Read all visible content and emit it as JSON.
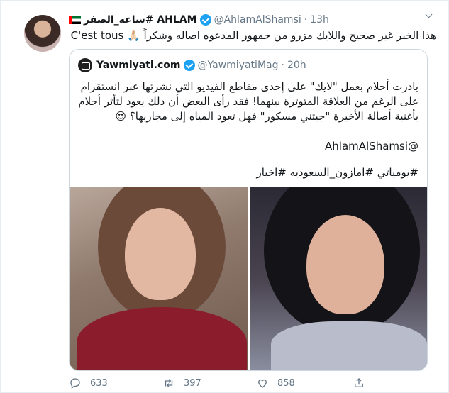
{
  "tweet": {
    "display_name": "ساعة_الصفر# AHLAM",
    "handle": "@AhlamAlShamsi",
    "separator": "·",
    "time": "13h",
    "text": "هذا الخبر غير صحيح واللايك مزرو من جمهور المدعوه اصاله وشكراً 🙏🏻 C'est tous"
  },
  "quote": {
    "display_name": "Yawmiyati.com",
    "handle": "@YawmiyatiMag",
    "separator": "·",
    "time": "20h",
    "text": "بادرت أحلام بعمل \"لايك\" على إحدى مقاطع الفيديو التي نشرتها عبر انستقرام على الرغم من العلاقة المتوترة بينهما! فقد رأى البعض أن ذلك يعود لتأثر أحلام بأغنية أصالة الأخيرة \"جيتني مسكور\" فهل تعود المياه إلى مجاريها؟ 😍",
    "mention": "@AhlamAlShamsi",
    "hashtags": "#يومياتي #امازون_السعوديه #اخبار"
  },
  "actions": {
    "replies": "633",
    "retweets": "397",
    "likes": "858"
  },
  "colors": {
    "accent": "#1da1f2",
    "muted": "#657786",
    "border": "#e6ecf0"
  },
  "icons": [
    "verified-badge-icon",
    "caret-down-icon",
    "reply-icon",
    "retweet-icon",
    "like-icon",
    "share-icon"
  ]
}
